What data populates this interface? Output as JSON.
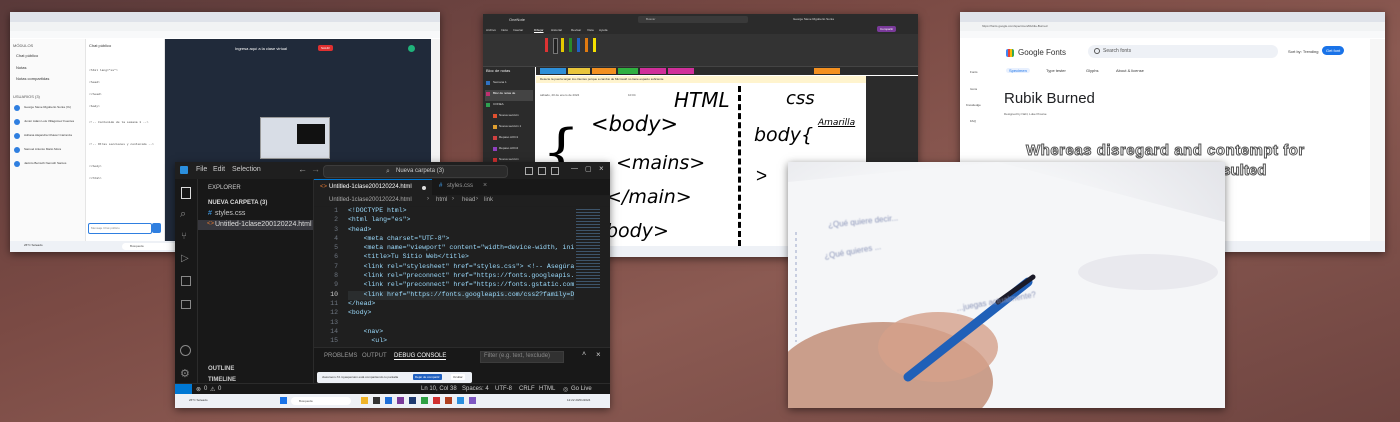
{
  "win1": {
    "chat_title": "Chat público",
    "sidebar_section": "MÓDULOS",
    "sidebar_items": [
      "Chat público",
      "Notas",
      "Notas compartidas"
    ],
    "users_label": "USUARIOS (3)",
    "users": [
      "George Steve Rigoberto Sonia (Yo)",
      "Junior Adam Luis Villagómez Fuentes",
      "Adriana Alejandra Chávez Carranza",
      "Samuel Antonio Mario Mora",
      "Jacinto Bernuth Nemoth Santos"
    ],
    "chat_lines": [
      "<html lang=\"es\">",
      "<head>",
      "</head>",
      "<body>",
      "<!-- Contenido de la semana 1 -->",
      "<!-- Otras secciones y contenido -->",
      "</body>",
      "</html>"
    ],
    "chat_input_placeholder": "Mensaje Chat público",
    "banner": "Ingresa aquí a la clase virtual",
    "banner_badge": "SALIR",
    "sharing": "Ahora estás compartiendo tu pantalla",
    "search": "Busqueda",
    "weather": "26°C Soleado"
  },
  "win2": {
    "app_title": "OneNote",
    "search": "Buscar",
    "user": "George Steve Rigoberto Sonia",
    "share_button": "Compartir",
    "menu": [
      "Archivo",
      "Inicio",
      "Insertar",
      "Dibujar",
      "Historial",
      "Revisar",
      "Vista",
      "Ayuda"
    ],
    "notebook_title": "Bloc de notas",
    "notebook_items": [
      "Semana 1",
      "Bloc de notas de",
      "CONEA",
      "Nueva sección",
      "Nueva sección 1",
      "Repaso AOC1",
      "Repaso AOC2",
      "Nueva sección"
    ],
    "date": "sábado, 20 de enero de 2024",
    "time": "10:04",
    "info_bar": "Detecte la puerta tarjan los clientes porque a cambio de Microsoft no tiene espacio suficiente",
    "ink": {
      "html": "HTML",
      "css": "css",
      "body_open": "<body>",
      "mains": "<mains>",
      "mains_close": "</main>",
      "body_close": "body>",
      "body_css": "body{",
      "annotate": "Amarilla",
      "arrow": ">"
    }
  },
  "win3": {
    "app_name": "Google Fonts",
    "search_placeholder": "Search fonts",
    "sort": "Sort by: Trending",
    "get_fonts": "Get font",
    "tabs": [
      "Specimen",
      "Type tester",
      "Glyphs",
      "About & license"
    ],
    "font_name": "Rubik Burned",
    "designer": "Designed by NaN, Luke Prowse",
    "sample_line1": "Whereas disregard and contempt for",
    "sample_line2": "resulted",
    "url": "https://fonts.google.com/specimen/Rubik+Burned",
    "side_nav": [
      "Fonts",
      "Icons",
      "Knowledge",
      "FAQ"
    ]
  },
  "win4": {
    "lines": [
      "¿Qué quiere decir...",
      "¿Qué quieres ...",
      "...juegas actualmente?"
    ]
  },
  "vscode": {
    "title": "Nueva carpeta (3)",
    "menu": [
      "File",
      "Edit",
      "Selection"
    ],
    "explorer_label": "EXPLORER",
    "folder": "NUEVA CARPETA (3)",
    "files": [
      "styles.css",
      "Untitled-1clase200120224.html"
    ],
    "tabs": [
      "Untitled-1clase200120224.html",
      "styles.css"
    ],
    "breadcrumb": [
      "Untitled-1clase200120224.html",
      "html",
      "head",
      "link"
    ],
    "code_lines": [
      {
        "n": "1",
        "text": "<!DOCTYPE html>"
      },
      {
        "n": "2",
        "text": "<html lang=\"es\">"
      },
      {
        "n": "3",
        "text": "<head>"
      },
      {
        "n": "4",
        "text": "    <meta charset=\"UTF-8\">"
      },
      {
        "n": "5",
        "text": "    <meta name=\"viewport\" content=\"width=device-width, initi"
      },
      {
        "n": "6",
        "text": "    <title>Tu Sitio Web</title>"
      },
      {
        "n": "7",
        "text": "    <link rel=\"stylesheet\" href=\"styles.css\"> <!-- Asegúrate"
      },
      {
        "n": "8",
        "text": "    <link rel=\"preconnect\" href=\"https://fonts.googleapis.co"
      },
      {
        "n": "9",
        "text": "    <link rel=\"preconnect\" href=\"https://fonts.gstatic.com\""
      },
      {
        "n": "10",
        "text": "    <link href=\"https://fonts.googleapis.com/css2?family=Dan"
      },
      {
        "n": "11",
        "text": "</head>"
      },
      {
        "n": "12",
        "text": "<body>"
      },
      {
        "n": "13",
        "text": ""
      },
      {
        "n": "14",
        "text": "    <nav>"
      },
      {
        "n": "15",
        "text": "      <ul>"
      }
    ],
    "panel_tabs": [
      "PROBLEMS",
      "OUTPUT",
      "DEBUG CONSOLE"
    ],
    "filter_placeholder": "Filter (e.g. text, !exclude)",
    "outline": "OUTLINE",
    "timeline": "TIMELINE",
    "status": {
      "errors": "0",
      "warnings": "0",
      "position": "Ln 10, Col 38",
      "spaces": "Spaces: 4",
      "encoding": "UTF-8",
      "eol": "CRLF",
      "lang": "HTML",
      "live": "Go Live"
    },
    "share_notice": "classroom-72.myaspersion está compartiendo tu pantalla",
    "share_stop": "Dejar de compartir",
    "share_hide": "Ocultar",
    "search_taskbar": "Busqueda",
    "weather": "26°C Soleado",
    "clock": "12:22 20/01/2024"
  }
}
